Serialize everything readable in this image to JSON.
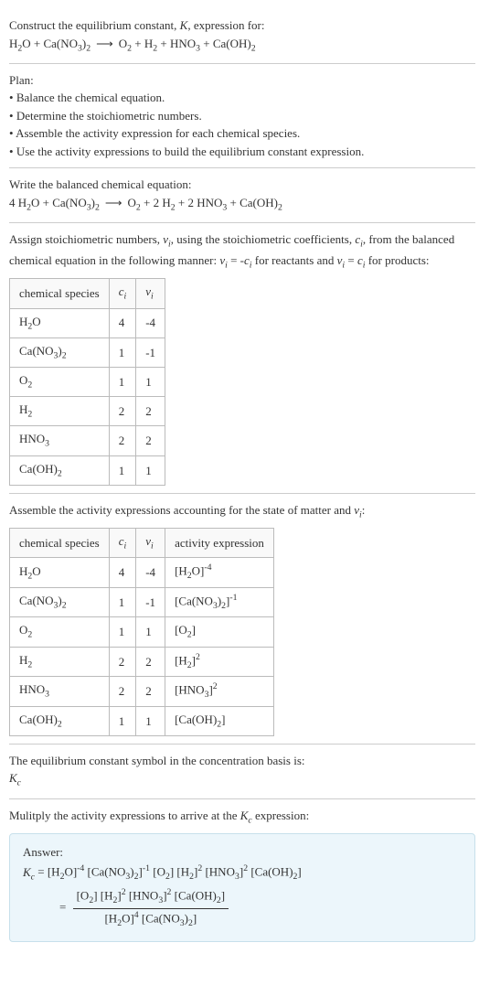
{
  "intro": {
    "line1": "Construct the equilibrium constant, K, expression for:",
    "eq": "H₂O + Ca(NO₃)₂ ⟶ O₂ + H₂ + HNO₃ + Ca(OH)₂"
  },
  "plan": {
    "title": "Plan:",
    "b1": "Balance the chemical equation.",
    "b2": "Determine the stoichiometric numbers.",
    "b3": "Assemble the activity expression for each chemical species.",
    "b4": "Use the activity expressions to build the equilibrium constant expression."
  },
  "balanced": {
    "title": "Write the balanced chemical equation:",
    "eq": "4 H₂O + Ca(NO₃)₂ ⟶ O₂ + 2 H₂ + 2 HNO₃ + Ca(OH)₂"
  },
  "stoich": {
    "desc1": "Assign stoichiometric numbers, νᵢ, using the stoichiometric coefficients, cᵢ, from the balanced chemical equation in the following manner: νᵢ = -cᵢ for reactants and νᵢ = cᵢ for products:",
    "h1": "chemical species",
    "h2": "cᵢ",
    "h3": "νᵢ",
    "r1": {
      "s": "H₂O",
      "c": "4",
      "v": "-4"
    },
    "r2": {
      "s": "Ca(NO₃)₂",
      "c": "1",
      "v": "-1"
    },
    "r3": {
      "s": "O₂",
      "c": "1",
      "v": "1"
    },
    "r4": {
      "s": "H₂",
      "c": "2",
      "v": "2"
    },
    "r5": {
      "s": "HNO₃",
      "c": "2",
      "v": "2"
    },
    "r6": {
      "s": "Ca(OH)₂",
      "c": "1",
      "v": "1"
    }
  },
  "activity": {
    "desc": "Assemble the activity expressions accounting for the state of matter and νᵢ:",
    "h1": "chemical species",
    "h2": "cᵢ",
    "h3": "νᵢ",
    "h4": "activity expression",
    "r1": {
      "s": "H₂O",
      "c": "4",
      "v": "-4",
      "a": "[H₂O]⁻⁴"
    },
    "r2": {
      "s": "Ca(NO₃)₂",
      "c": "1",
      "v": "-1",
      "a": "[Ca(NO₃)₂]⁻¹"
    },
    "r3": {
      "s": "O₂",
      "c": "1",
      "v": "1",
      "a": "[O₂]"
    },
    "r4": {
      "s": "H₂",
      "c": "2",
      "v": "2",
      "a": "[H₂]²"
    },
    "r5": {
      "s": "HNO₃",
      "c": "2",
      "v": "2",
      "a": "[HNO₃]²"
    },
    "r6": {
      "s": "Ca(OH)₂",
      "c": "1",
      "v": "1",
      "a": "[Ca(OH)₂]"
    }
  },
  "kc": {
    "line1": "The equilibrium constant symbol in the concentration basis is:",
    "symbol": "K_c"
  },
  "final": {
    "desc": "Mulitply the activity expressions to arrive at the K_c expression:",
    "answer_label": "Answer:",
    "line1": "K_c = [H₂O]⁻⁴ [Ca(NO₃)₂]⁻¹ [O₂] [H₂]² [HNO₃]² [Ca(OH)₂]",
    "num": "[O₂] [H₂]² [HNO₃]² [Ca(OH)₂]",
    "den": "[H₂O]⁴ [Ca(NO₃)₂]"
  }
}
